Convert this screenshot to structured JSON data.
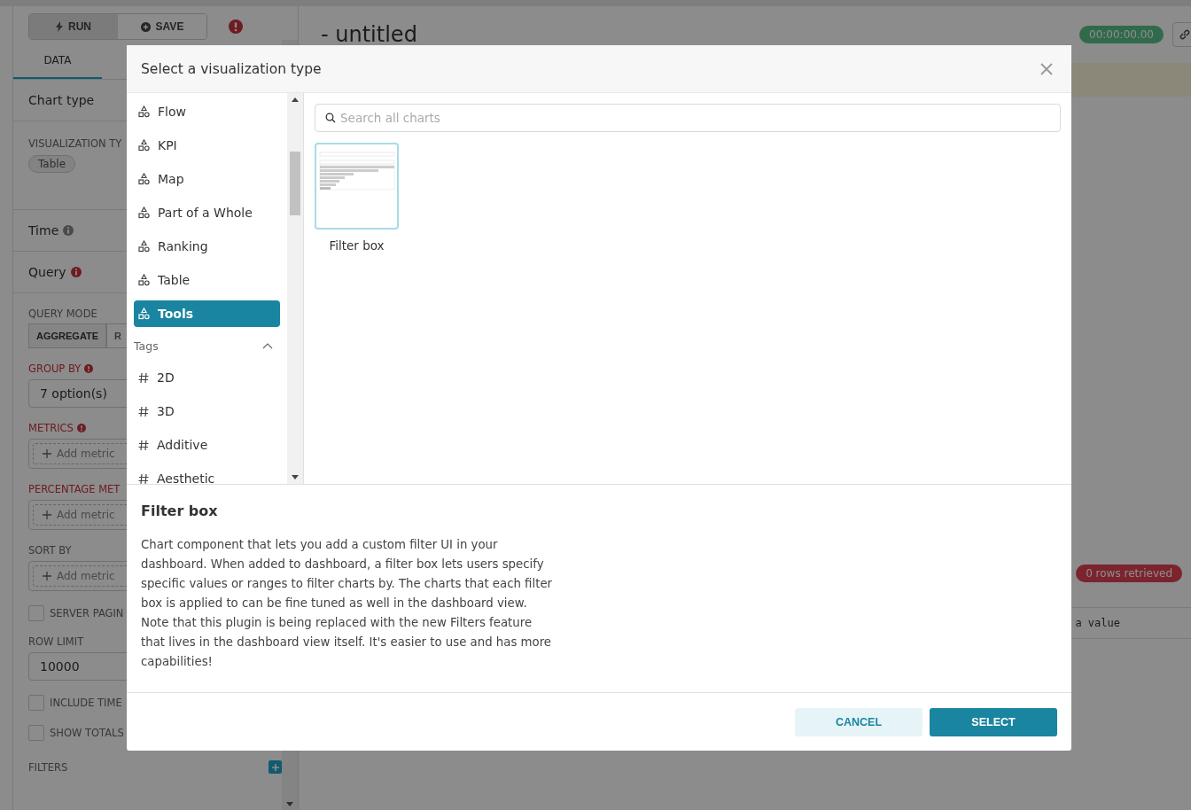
{
  "explore_panel": {
    "actions": [
      {
        "label": "RUN",
        "kind": "run"
      },
      {
        "label": "SAVE",
        "kind": "save"
      }
    ],
    "tabs": [
      {
        "label": "DATA",
        "selected": true
      }
    ],
    "chart_type": {
      "title": "Chart type",
      "field_label": "VISUALIZATION TY",
      "value": "Table"
    },
    "sections": [
      {
        "title": "Time",
        "error": false
      },
      {
        "title": "Query",
        "error": true
      }
    ],
    "query_mode": {
      "label": "QUERY MODE",
      "options": [
        {
          "label": "AGGREGATE",
          "selected": true
        },
        {
          "label": "R",
          "selected": false
        }
      ]
    },
    "controls": [
      {
        "kind": "select",
        "label": "GROUP BY",
        "error": true,
        "error_icon": true,
        "value": "7 option(s)"
      },
      {
        "kind": "metric",
        "label": "METRICS",
        "error": true,
        "error_icon": true,
        "placeholder": "Add metric"
      },
      {
        "kind": "metric",
        "label": "PERCENTAGE MET",
        "error": true,
        "error_icon": false,
        "placeholder": "Add metric"
      },
      {
        "kind": "metric",
        "label": "SORT BY",
        "error": false,
        "error_icon": false,
        "placeholder": "Add metric"
      },
      {
        "kind": "checkbox",
        "label": "SERVER PAGIN",
        "checked": false
      },
      {
        "kind": "input",
        "label": "ROW LIMIT",
        "error": false,
        "error_icon": false,
        "value": "10000"
      },
      {
        "kind": "checkbox",
        "label": "INCLUDE TIME",
        "checked": false
      },
      {
        "kind": "checkbox",
        "label": "SHOW TOTALS",
        "checked": false
      },
      {
        "kind": "header",
        "label": "FILTERS"
      }
    ]
  },
  "main": {
    "title": "- untitled",
    "timer": "00:00:00.00",
    "rows_badge": "0 rows retrieved",
    "cell": "a value"
  },
  "modal": {
    "title": "Select a visualization type",
    "categories": [
      {
        "label": "Flow",
        "selected": false
      },
      {
        "label": "KPI",
        "selected": false
      },
      {
        "label": "Map",
        "selected": false
      },
      {
        "label": "Part of a Whole",
        "selected": false
      },
      {
        "label": "Ranking",
        "selected": false
      },
      {
        "label": "Table",
        "selected": false
      },
      {
        "label": "Tools",
        "selected": true
      }
    ],
    "tags_header": {
      "label": "Tags",
      "expanded": true
    },
    "tags": [
      {
        "label": "2D",
        "selected": false
      },
      {
        "label": "3D",
        "selected": false
      },
      {
        "label": "Additive",
        "selected": false
      },
      {
        "label": "Aesthetic",
        "selected": false
      }
    ],
    "search": {
      "placeholder": "Search all charts"
    },
    "charts": [
      {
        "name": "Filter box",
        "selected": true
      }
    ],
    "detail": {
      "title": "Filter box",
      "description": "Chart component that lets you add a custom filter UI in your dashboard. When added to dashboard, a filter box lets users specify specific values or ranges to filter charts by. The charts that each filter box is applied to can be fine tuned as well in the dashboard view. Note that this plugin is being replaced with the new Filters feature that lives in the dashboard view itself. It's easier to use and has more capabilities!"
    },
    "buttons": [
      {
        "label": "CANCEL",
        "kind": "secondary"
      },
      {
        "label": "SELECT",
        "kind": "primary"
      }
    ]
  }
}
